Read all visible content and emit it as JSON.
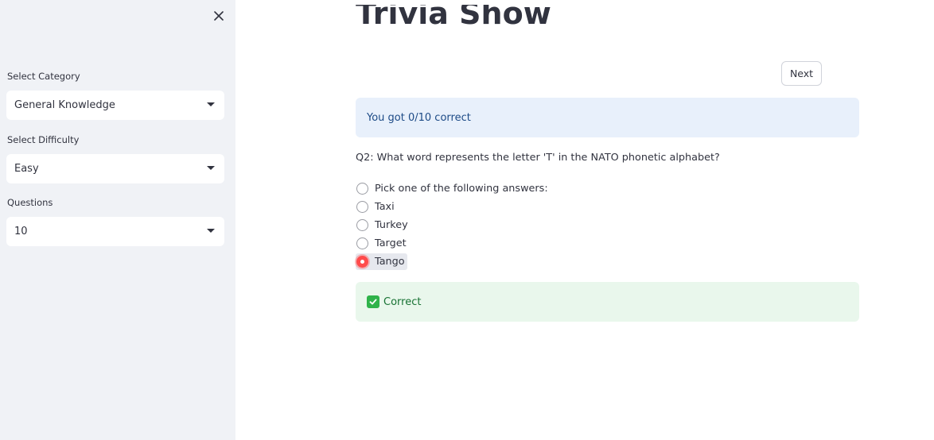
{
  "sidebar": {
    "close_icon": "close-icon",
    "category": {
      "label": "Select Category",
      "value": "General Knowledge"
    },
    "difficulty": {
      "label": "Select Difficulty",
      "value": "Easy"
    },
    "questions": {
      "label": "Questions",
      "value": "10"
    }
  },
  "main": {
    "title": "Trivia Show",
    "next_label": "Next",
    "score_text": "You got 0/10 correct",
    "question": "Q2: What word represents the letter 'T' in the NATO phonetic alphabet?",
    "options": [
      {
        "label": "Pick one of the following answers:",
        "selected": false
      },
      {
        "label": "Taxi",
        "selected": false
      },
      {
        "label": "Turkey",
        "selected": false
      },
      {
        "label": "Target",
        "selected": false
      },
      {
        "label": "Tango",
        "selected": true
      }
    ],
    "result_icon": "check-icon",
    "result_text": "Correct"
  },
  "colors": {
    "sidebar_bg": "#f0f2f6",
    "accent": "#ff4b4b",
    "info_bg": "#e8f0fb",
    "info_text": "#1c4a86",
    "success_bg": "#e9f7ec",
    "success_text": "#177233"
  }
}
